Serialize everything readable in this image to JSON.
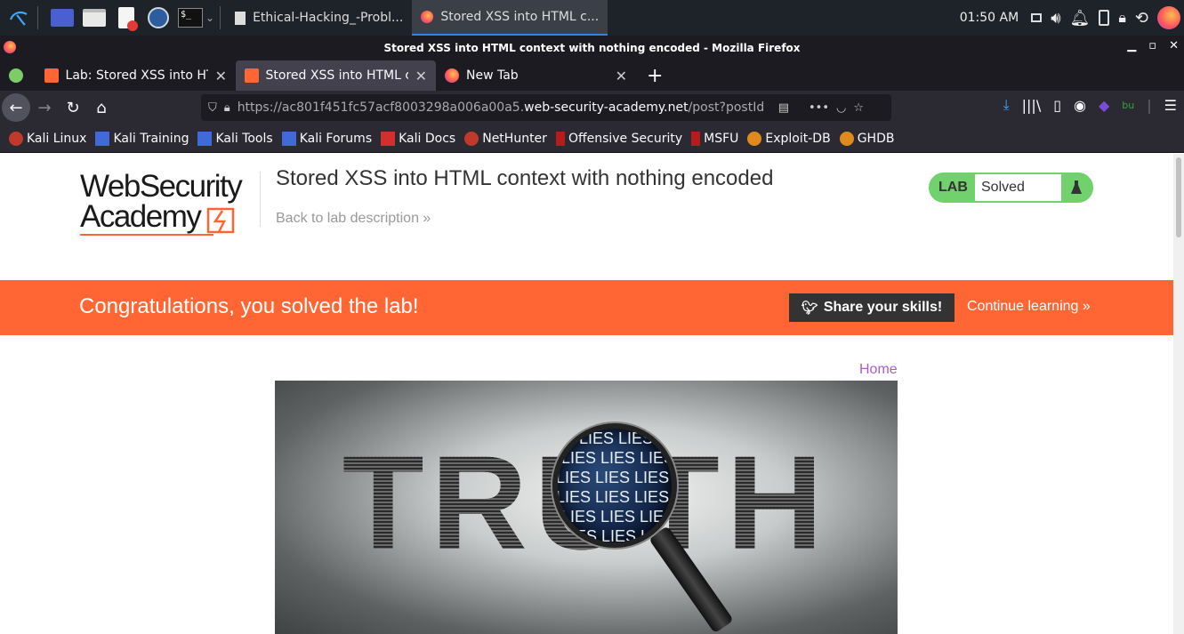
{
  "taskbar": {
    "tasks": [
      {
        "label": "Ethical-Hacking_-Probl..."
      },
      {
        "label": "Stored XSS into HTML c..."
      }
    ],
    "clock": "01:50 AM"
  },
  "window": {
    "title": "Stored XSS into HTML context with nothing encoded - Mozilla Firefox"
  },
  "tabs": [
    {
      "label": "Lab: Stored XSS into HTM"
    },
    {
      "label": "Stored XSS into HTML co"
    },
    {
      "label": "New Tab"
    }
  ],
  "navbar": {
    "url_prefix": "https://ac801f451fc57acf8003298a006a00a5.",
    "url_domain": "web-security-academy.net",
    "url_path": "/post?postId"
  },
  "bookmarks": [
    {
      "label": "Kali Linux"
    },
    {
      "label": "Kali Training"
    },
    {
      "label": "Kali Tools"
    },
    {
      "label": "Kali Forums"
    },
    {
      "label": "Kali Docs"
    },
    {
      "label": "NetHunter"
    },
    {
      "label": "Offensive Security"
    },
    {
      "label": "MSFU"
    },
    {
      "label": "Exploit-DB"
    },
    {
      "label": "GHDB"
    }
  ],
  "header": {
    "logo_line1": "WebSecurity",
    "logo_line2": "Academy",
    "title": "Stored XSS into HTML context with nothing encoded",
    "back_link": "Back to lab description »",
    "lab_label": "LAB",
    "lab_status": "Solved"
  },
  "banner": {
    "text": "Congratulations, you solved the lab!",
    "share_label": "Share your skills!",
    "continue_label": "Continue learning »"
  },
  "content": {
    "home_link": "Home",
    "hero_word": "TRUTH",
    "hero_lens_lines": [
      "LIES LIES",
      "LIES LIES LIES",
      "LIES LIES LIES LI",
      "LIES LIES LIES LI",
      "LIES LIES LIES",
      "ES LIES LIES"
    ]
  },
  "colors": {
    "accent": "#ff6633",
    "lab_solved": "#70d16d",
    "link_purple": "#b05cc6"
  }
}
